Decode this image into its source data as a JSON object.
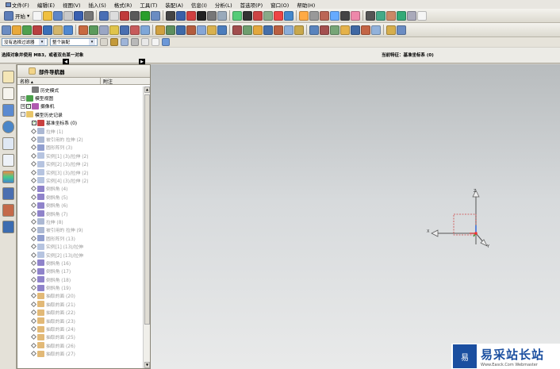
{
  "menu": [
    {
      "label": "文件(F)"
    },
    {
      "label": "编辑(E)"
    },
    {
      "label": "视图(V)"
    },
    {
      "label": "插入(S)"
    },
    {
      "label": "格式(R)"
    },
    {
      "label": "工具(T)"
    },
    {
      "label": "装配(A)"
    },
    {
      "label": "信息(I)"
    },
    {
      "label": "分析(L)"
    },
    {
      "label": "首选项(P)"
    },
    {
      "label": "窗口(O)"
    },
    {
      "label": "帮助(H)"
    }
  ],
  "toolbar": {
    "start_label": "开始"
  },
  "filter": {
    "type_filter": "没有选择过滤器",
    "assembly_filter": "整个装配"
  },
  "status": {
    "prompt": "选择对象并使用 MB3，或者双击某一对象",
    "current_feature": "当前特征：基准坐标系 (0)"
  },
  "navigator": {
    "title": "部件导航器",
    "col_name": "名称",
    "col_note": "附注",
    "rows": [
      {
        "label": "历史模式",
        "depth": 1,
        "expand": "",
        "icon": "clock",
        "dim": false
      },
      {
        "label": "模型视图",
        "depth": 0,
        "expand": "+",
        "icon": "views",
        "dim": false
      },
      {
        "label": "摄像机",
        "depth": 0,
        "expand": "+",
        "icon": "camera",
        "check": true,
        "dim": false
      },
      {
        "label": "模型历史记录",
        "depth": 0,
        "expand": "-",
        "icon": "folder",
        "dim": false
      },
      {
        "label": "基准坐标系 (0)",
        "depth": 1,
        "expand": "",
        "icon": "csys",
        "check": true,
        "dim": false
      },
      {
        "label": "拉伸 (1)",
        "depth": 1,
        "icon": "extrude",
        "dim": true
      },
      {
        "label": "被引用的 拉伸 (2)",
        "depth": 1,
        "icon": "extrude",
        "dim": true
      },
      {
        "label": "圆形阵列 (3)",
        "depth": 1,
        "icon": "pattern",
        "dim": true
      },
      {
        "label": "实例[1] (3)/拉伸 (2)",
        "depth": 1,
        "icon": "instance",
        "dim": true
      },
      {
        "label": "实例[2] (3)/拉伸 (2)",
        "depth": 1,
        "icon": "instance",
        "dim": true
      },
      {
        "label": "实例[3] (3)/拉伸 (2)",
        "depth": 1,
        "icon": "instance",
        "dim": true
      },
      {
        "label": "实例[4] (3)/拉伸 (2)",
        "depth": 1,
        "icon": "instance",
        "dim": true
      },
      {
        "label": "倒斜角 (4)",
        "depth": 1,
        "icon": "chamfer",
        "dim": true
      },
      {
        "label": "倒斜角 (5)",
        "depth": 1,
        "icon": "chamfer",
        "dim": true
      },
      {
        "label": "倒斜角 (6)",
        "depth": 1,
        "icon": "chamfer",
        "dim": true
      },
      {
        "label": "倒斜角 (7)",
        "depth": 1,
        "icon": "chamfer",
        "dim": true
      },
      {
        "label": "拉伸 (8)",
        "depth": 1,
        "icon": "extrude",
        "dim": true
      },
      {
        "label": "被引用的 拉伸 (9)",
        "depth": 1,
        "icon": "extrude",
        "dim": true
      },
      {
        "label": "圆形阵列 (13)",
        "depth": 1,
        "icon": "pattern",
        "dim": true
      },
      {
        "label": "实例[1] (13)/拉伸",
        "depth": 1,
        "icon": "instance",
        "dim": true
      },
      {
        "label": "实例[2] (13)/拉伸",
        "depth": 1,
        "icon": "instance",
        "dim": true
      },
      {
        "label": "倒斜角 (16)",
        "depth": 1,
        "icon": "chamfer",
        "dim": true
      },
      {
        "label": "倒斜角 (17)",
        "depth": 1,
        "icon": "chamfer",
        "dim": true
      },
      {
        "label": "倒斜角 (18)",
        "depth": 1,
        "icon": "chamfer",
        "dim": true
      },
      {
        "label": "倒斜角 (19)",
        "depth": 1,
        "icon": "chamfer",
        "dim": true
      },
      {
        "label": "抽取的面 (20)",
        "depth": 1,
        "icon": "face",
        "dim": true
      },
      {
        "label": "抽取的面 (21)",
        "depth": 1,
        "icon": "face",
        "dim": true
      },
      {
        "label": "抽取的面 (22)",
        "depth": 1,
        "icon": "face",
        "dim": true
      },
      {
        "label": "抽取的面 (23)",
        "depth": 1,
        "icon": "face",
        "dim": true
      },
      {
        "label": "抽取的面 (24)",
        "depth": 1,
        "icon": "face",
        "dim": true
      },
      {
        "label": "抽取的面 (25)",
        "depth": 1,
        "icon": "face",
        "dim": true
      },
      {
        "label": "抽取的面 (26)",
        "depth": 1,
        "icon": "face",
        "dim": true
      },
      {
        "label": "抽取的面 (27)",
        "depth": 1,
        "icon": "face",
        "dim": true
      }
    ]
  },
  "viewport": {
    "axis_x": "X",
    "axis_y": "Y",
    "axis_z": "Z"
  },
  "watermark": {
    "logo": "易",
    "cn": "易采站长站",
    "en": "Www.Easck.Com  Webmaster"
  },
  "colors": {
    "accent": "#1b4fa0",
    "selection": "#ff0000",
    "viewport_top": "#b8bcbe",
    "viewport_bottom": "#e9eaea"
  }
}
